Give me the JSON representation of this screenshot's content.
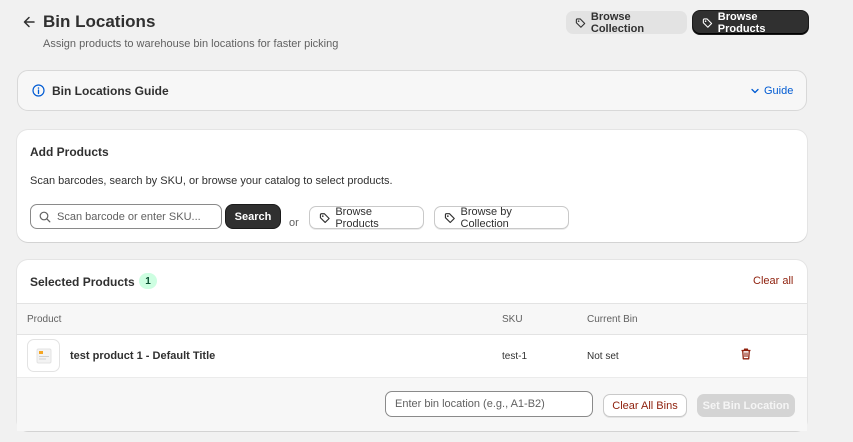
{
  "header": {
    "title": "Bin Locations",
    "subtitle": "Assign products to warehouse bin locations for faster picking",
    "browse_collection_label": "Browse Collection",
    "browse_products_label": "Browse Products"
  },
  "guide": {
    "title": "Bin Locations Guide",
    "toggle_label": "Guide"
  },
  "add_products": {
    "title": "Add Products",
    "description": "Scan barcodes, search by SKU, or browse your catalog to select products.",
    "search_placeholder": "Scan barcode or enter SKU...",
    "search_button": "Search",
    "or_text": "or",
    "browse_products_button": "Browse Products",
    "browse_collection_button": "Browse by Collection"
  },
  "selected_products": {
    "title": "Selected Products",
    "count": "1",
    "clear_all_label": "Clear all",
    "columns": {
      "product": "Product",
      "sku": "SKU",
      "current_bin": "Current Bin"
    },
    "rows": [
      {
        "name": "test product 1 - Default Title",
        "sku": "test-1",
        "current_bin": "Not set"
      }
    ],
    "bin_input_placeholder": "Enter bin location (e.g., A1-B2)",
    "clear_all_bins_label": "Clear All Bins",
    "set_bin_label": "Set Bin Location"
  },
  "colors": {
    "primary_button": "#303030",
    "link_blue": "#005bd3",
    "critical_text": "#8e1f0b",
    "success_badge_bg": "#cdfee1",
    "page_bg": "#f1f1f1"
  }
}
